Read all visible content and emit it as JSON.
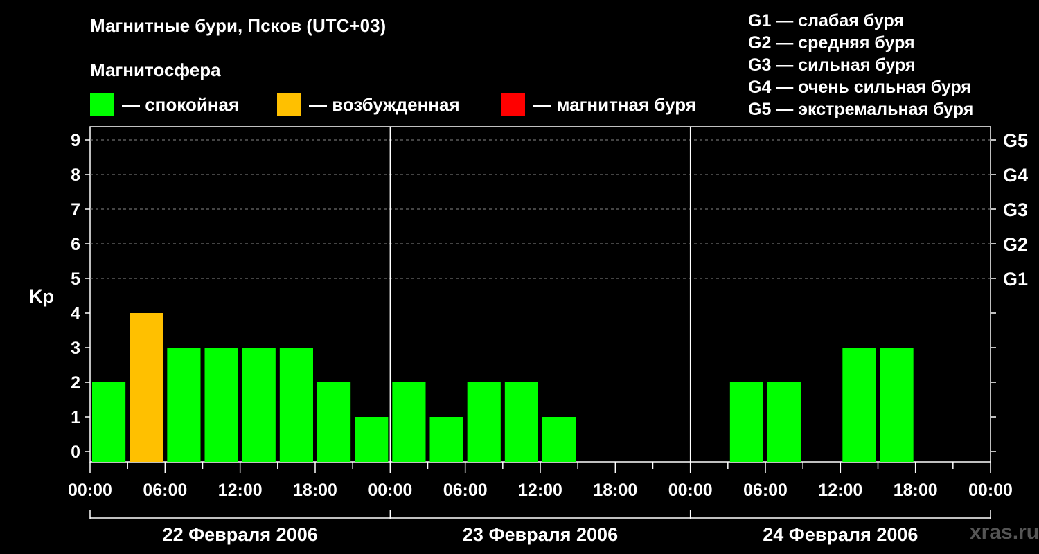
{
  "header": {
    "title": "Магнитные бури, Псков (UTC+03)",
    "subtitle": "Магнитосфера"
  },
  "legend": [
    {
      "label": "— спокойная",
      "color": "#00ff00"
    },
    {
      "label": "— возбужденная",
      "color": "#ffc000"
    },
    {
      "label": "— магнитная буря",
      "color": "#ff0000"
    }
  ],
  "storm_levels": [
    "G1 — слабая буря",
    "G2 — средняя буря",
    "G3 — сильная буря",
    "G4 — очень сильная буря",
    "G5 — экстремальная буря"
  ],
  "watermark": "xras.ru",
  "chart_data": {
    "type": "bar",
    "title": "Магнитные бури, Псков (UTC+03)",
    "ylabel": "Kp",
    "ylim": [
      0,
      9
    ],
    "yticks": [
      "0",
      "1",
      "2",
      "3",
      "4",
      "5",
      "6",
      "7",
      "8",
      "9"
    ],
    "right_ticks": [
      {
        "value": 5,
        "label": "G1"
      },
      {
        "value": 6,
        "label": "G2"
      },
      {
        "value": 7,
        "label": "G3"
      },
      {
        "value": 8,
        "label": "G4"
      },
      {
        "value": 9,
        "label": "G5"
      }
    ],
    "xtick_labels": [
      "00:00",
      "06:00",
      "12:00",
      "18:00",
      "00:00",
      "06:00",
      "12:00",
      "18:00",
      "00:00",
      "06:00",
      "12:00",
      "18:00",
      "00:00"
    ],
    "days": [
      "22 Февраля 2006",
      "23 Февраля 2006",
      "24 Февраля 2006"
    ],
    "bar_interval_hours": 3,
    "grid": "horizontal dashed at Kp 5–9",
    "values": [
      2,
      4,
      3,
      3,
      3,
      3,
      2,
      1,
      2,
      1,
      2,
      2,
      1,
      null,
      null,
      null,
      null,
      2,
      2,
      null,
      3,
      3,
      null,
      null
    ],
    "colors": [
      "#00ff00",
      "#ffc000",
      "#00ff00",
      "#00ff00",
      "#00ff00",
      "#00ff00",
      "#00ff00",
      "#00ff00",
      "#00ff00",
      "#00ff00",
      "#00ff00",
      "#00ff00",
      "#00ff00",
      null,
      null,
      null,
      null,
      "#00ff00",
      "#00ff00",
      null,
      "#00ff00",
      "#00ff00",
      null,
      null
    ]
  }
}
